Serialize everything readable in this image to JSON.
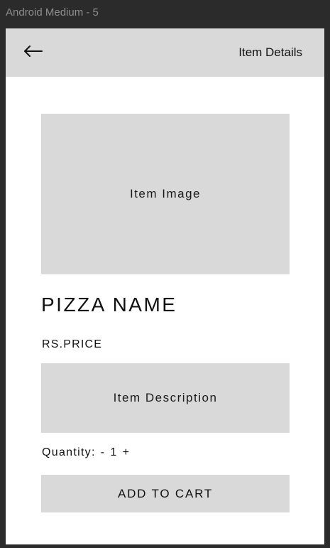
{
  "frame": {
    "label": "Android Medium - 5"
  },
  "header": {
    "back_icon": "arrow-left-icon",
    "title": "Item Details"
  },
  "item": {
    "image_placeholder": "Item Image",
    "name": "PIZZA NAME",
    "price": "RS.PRICE",
    "description_placeholder": "Item Description"
  },
  "quantity": {
    "label": "Quantity:",
    "decrement": "-",
    "value": "1",
    "increment": "+"
  },
  "actions": {
    "add_to_cart": "ADD TO CART"
  },
  "colors": {
    "outer_background": "#2b2b2b",
    "screen_background": "#ffffff",
    "placeholder_gray": "#d9d9d9",
    "text": "#111111",
    "frame_label": "#8e8e8e"
  }
}
